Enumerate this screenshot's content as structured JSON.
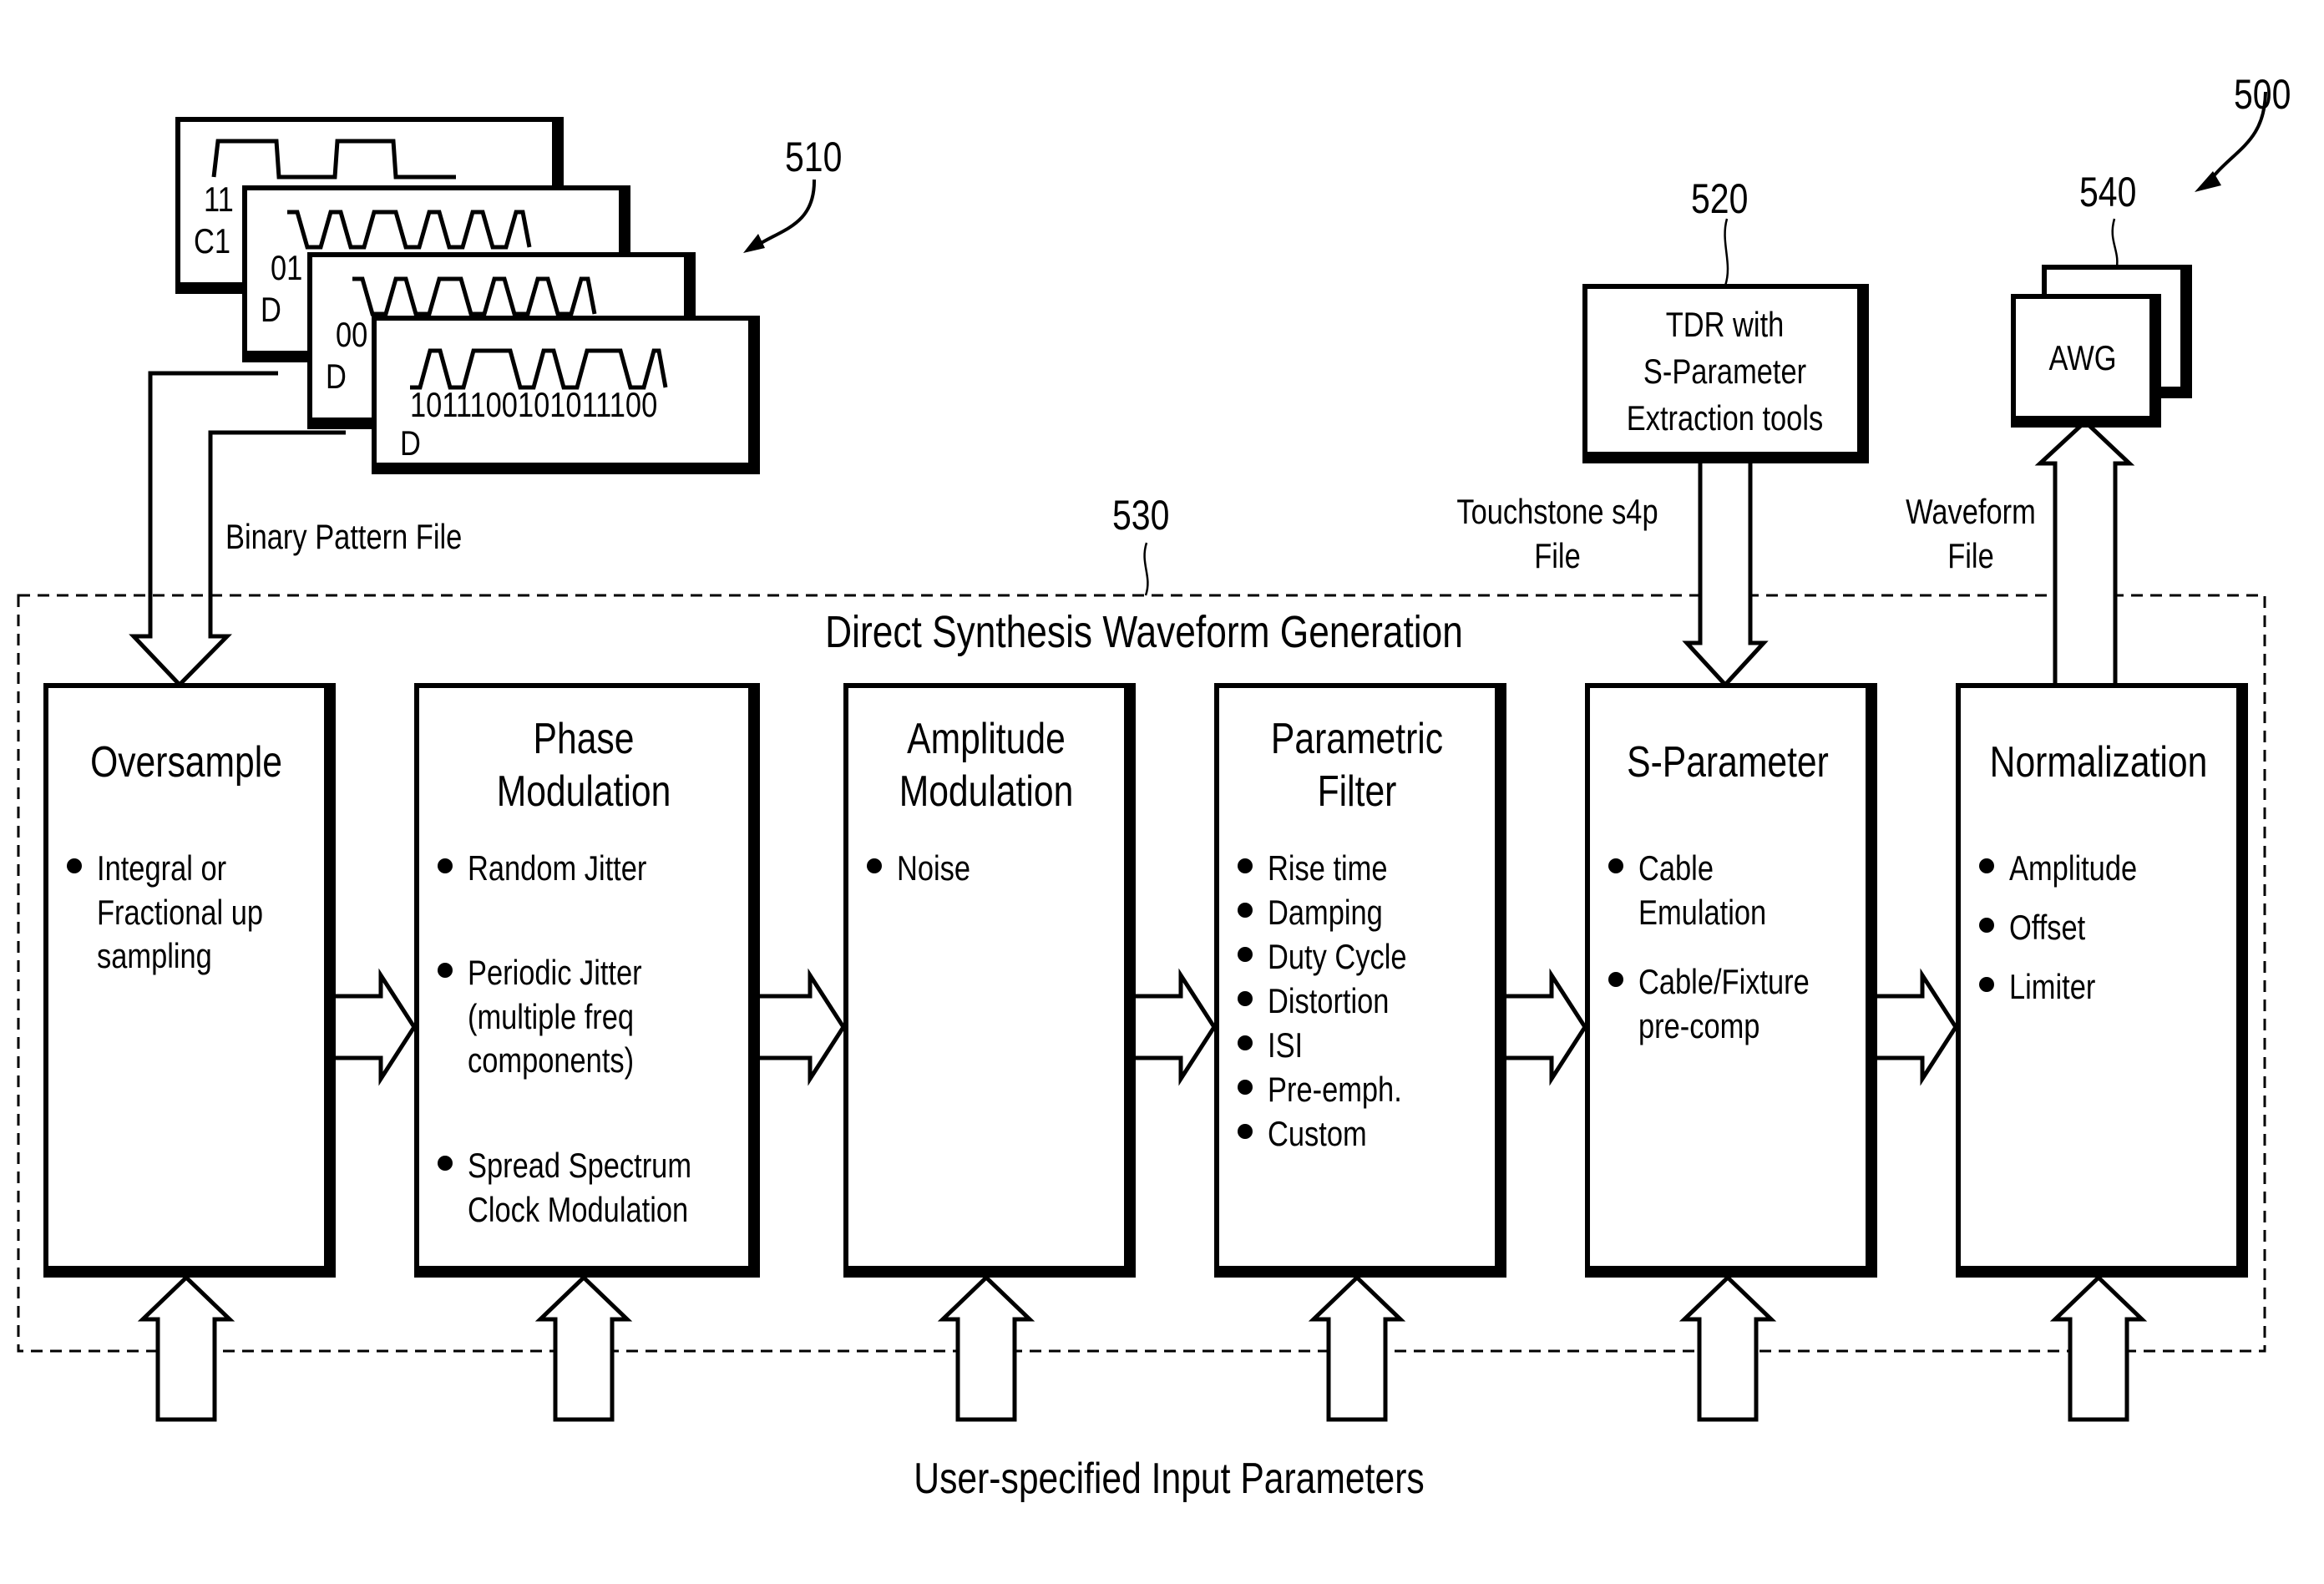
{
  "figure_ref": "500",
  "pattern_files": {
    "ref": "510",
    "label": "Binary Pattern File",
    "cards": [
      {
        "code": "11",
        "type": "C1"
      },
      {
        "code": "01",
        "type": "D"
      },
      {
        "code": "00",
        "type": "D"
      },
      {
        "code": "1011100101011100",
        "type": "D"
      }
    ]
  },
  "tdr": {
    "ref": "520",
    "lines": [
      "TDR with",
      "S-Parameter",
      "Extraction tools"
    ],
    "output_label": [
      "Touchstone s4p",
      "File"
    ]
  },
  "awg": {
    "ref": "540",
    "label": "AWG",
    "input_label": [
      "Waveform",
      "File"
    ]
  },
  "synthesis": {
    "ref": "530",
    "title": "Direct Synthesis Waveform Generation",
    "blocks": [
      {
        "title": [
          "Oversample"
        ],
        "items": [
          [
            "Integral or",
            "Fractional up",
            "sampling"
          ]
        ]
      },
      {
        "title": [
          "Phase",
          "Modulation"
        ],
        "items": [
          [
            "Random Jitter"
          ],
          [
            "Periodic Jitter",
            "(multiple freq",
            "components)"
          ],
          [
            "Spread Spectrum",
            "Clock Modulation"
          ]
        ]
      },
      {
        "title": [
          "Amplitude",
          "Modulation"
        ],
        "items": [
          [
            "Noise"
          ]
        ]
      },
      {
        "title": [
          "Parametric",
          "Filter"
        ],
        "items": [
          [
            "Rise time"
          ],
          [
            "Damping"
          ],
          [
            "Duty Cycle"
          ],
          [
            "Distortion"
          ],
          [
            "ISI"
          ],
          [
            "Pre-emph."
          ],
          [
            "Custom"
          ]
        ]
      },
      {
        "title": [
          "S-Parameter"
        ],
        "items": [
          [
            "Cable",
            "Emulation"
          ],
          [
            "Cable/Fixture",
            "pre-comp"
          ]
        ]
      },
      {
        "title": [
          "Normalization"
        ],
        "items": [
          [
            "Amplitude"
          ],
          [
            "Offset"
          ],
          [
            "Limiter"
          ]
        ]
      }
    ]
  },
  "user_inputs_label": "User-specified Input Parameters"
}
